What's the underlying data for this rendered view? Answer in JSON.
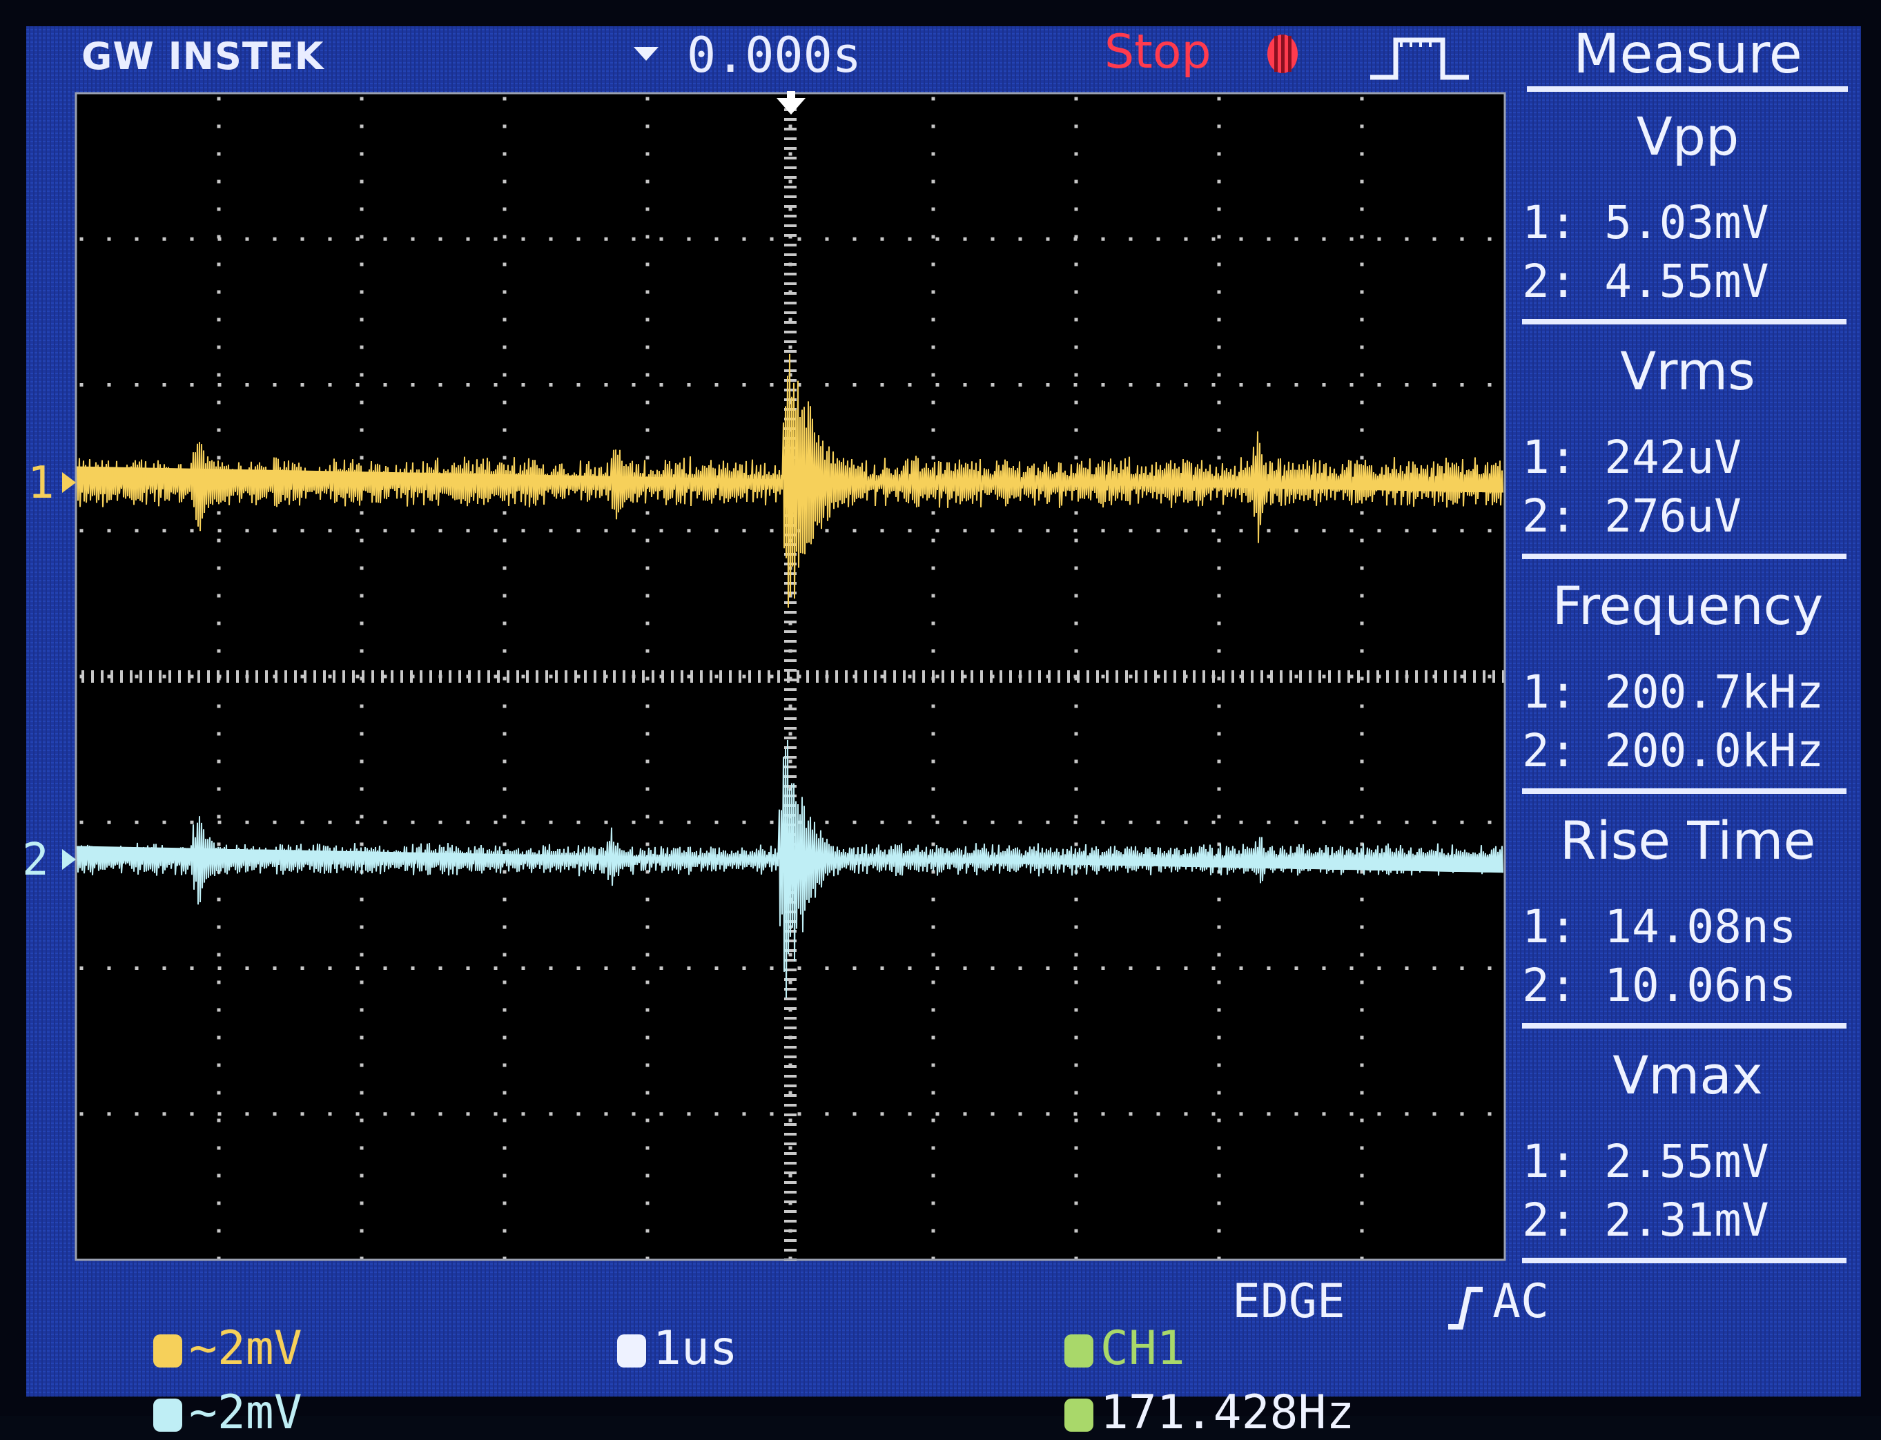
{
  "header": {
    "brand": "GW INSTEK",
    "trigger_time": "0.000s",
    "run_status": "Stop",
    "status_icon": "stop-record-icon",
    "trigger_mode_icon": "single-pulse-icon"
  },
  "measure": {
    "title": "Measure",
    "items": [
      {
        "name": "Vpp",
        "ch1": "1: 5.03mV",
        "ch2": "2: 4.55mV"
      },
      {
        "name": "Vrms",
        "ch1": "1: 242uV",
        "ch2": "2: 276uV"
      },
      {
        "name": "Frequency",
        "ch1": "1: 200.7kHz",
        "ch2": "2: 200.0kHz"
      },
      {
        "name": "Rise Time",
        "ch1": "1: 14.08ns",
        "ch2": "2: 10.06ns"
      },
      {
        "name": "Vmax",
        "ch1": "1: 2.55mV",
        "ch2": "2: 2.31mV"
      }
    ]
  },
  "channels": {
    "ch1": {
      "marker": "1",
      "scale": "~2mV",
      "color": "#f6d05a"
    },
    "ch2": {
      "marker": "2",
      "scale": "~2mV",
      "color": "#bfeef5"
    }
  },
  "footer": {
    "timebase": "1us",
    "trigger_source": "CH1",
    "trigger_type": "EDGE",
    "trigger_coupling": "AC",
    "trigger_frequency": "171.428Hz"
  },
  "colors": {
    "bezel_blue": "#1f3aa5",
    "screen_black": "#000000",
    "grid_dots": "#c8c8c8",
    "trigger_marker": "#ffffff",
    "status_red": "#ff3b4e",
    "footer_green": "#a9d86a"
  }
}
